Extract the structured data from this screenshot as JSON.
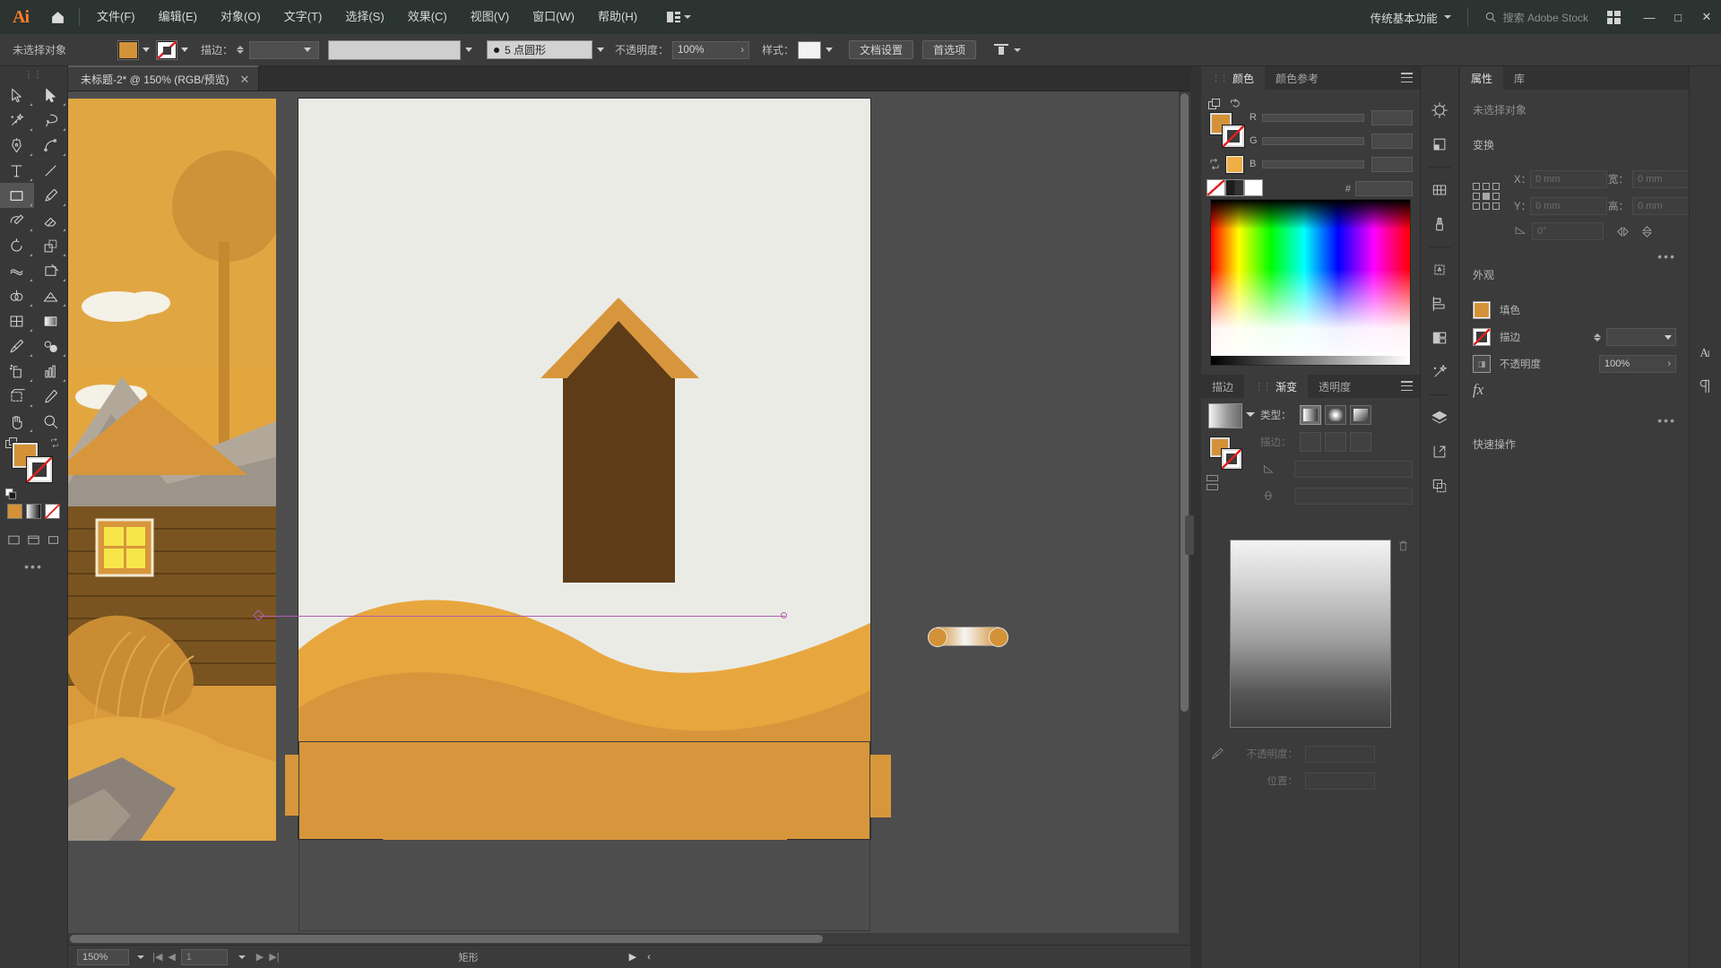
{
  "app": {
    "name": "Ai",
    "logo_color": "#ff7c2b",
    "accent_orange": "#d49238"
  },
  "menubar": {
    "home_icon": "home-icon",
    "items": [
      {
        "label": "文件(F)"
      },
      {
        "label": "编辑(E)"
      },
      {
        "label": "对象(O)"
      },
      {
        "label": "文字(T)"
      },
      {
        "label": "选择(S)"
      },
      {
        "label": "效果(C)"
      },
      {
        "label": "视图(V)"
      },
      {
        "label": "窗口(W)"
      },
      {
        "label": "帮助(H)"
      }
    ],
    "arrange_label": "",
    "workspace": "传统基本功能",
    "search_placeholder": "搜索 Adobe Stock",
    "window_buttons": [
      "—",
      "□",
      "✕"
    ]
  },
  "controlbar": {
    "selection_status": "未选择对象",
    "fill_color": "#d49238",
    "stroke_label": "描边：",
    "stroke_weight": "",
    "brush_label": "5 点圆形",
    "opacity_label": "不透明度：",
    "opacity_value": "100%",
    "style_label": "样式：",
    "doc_setup_button": "文档设置",
    "preferences_button": "首选项"
  },
  "toolbar": {
    "tools": [
      {
        "name": "selection-tool",
        "active": false
      },
      {
        "name": "direct-selection-tool",
        "active": false
      },
      {
        "name": "magic-wand-tool",
        "active": false
      },
      {
        "name": "lasso-tool",
        "active": false
      },
      {
        "name": "pen-tool",
        "active": false
      },
      {
        "name": "curvature-tool",
        "active": false
      },
      {
        "name": "type-tool",
        "active": false
      },
      {
        "name": "line-segment-tool",
        "active": false
      },
      {
        "name": "rectangle-tool",
        "active": true
      },
      {
        "name": "paintbrush-tool",
        "active": false
      },
      {
        "name": "shaper-tool",
        "active": false
      },
      {
        "name": "eraser-tool",
        "active": false
      },
      {
        "name": "rotate-tool",
        "active": false
      },
      {
        "name": "scale-tool",
        "active": false
      },
      {
        "name": "width-tool",
        "active": false
      },
      {
        "name": "free-transform-tool",
        "active": false
      },
      {
        "name": "shape-builder-tool",
        "active": false
      },
      {
        "name": "perspective-grid-tool",
        "active": false
      },
      {
        "name": "mesh-tool",
        "active": false
      },
      {
        "name": "gradient-tool",
        "active": false
      },
      {
        "name": "eyedropper-tool",
        "active": false
      },
      {
        "name": "blend-tool",
        "active": false
      },
      {
        "name": "symbol-sprayer-tool",
        "active": false
      },
      {
        "name": "column-graph-tool",
        "active": false
      },
      {
        "name": "artboard-tool",
        "active": false
      },
      {
        "name": "slice-tool",
        "active": false
      },
      {
        "name": "hand-tool",
        "active": false
      },
      {
        "name": "zoom-tool",
        "active": false
      }
    ],
    "fill_color": "#d49238",
    "stroke_color": "none"
  },
  "document": {
    "tab_title": "未标题-2* @ 150% (RGB/预览)",
    "close_label": "✕"
  },
  "statusbar": {
    "zoom": "150%",
    "page": "1",
    "tool_name": "矩形"
  },
  "panels": {
    "color": {
      "tabs": [
        {
          "label": "颜色",
          "active": true
        },
        {
          "label": "颜色参考",
          "active": false
        }
      ],
      "channels": [
        {
          "label": "R",
          "value": ""
        },
        {
          "label": "G",
          "value": ""
        },
        {
          "label": "B",
          "value": ""
        }
      ],
      "hex_label": "#",
      "hex_value": ""
    },
    "gradient": {
      "tabs": [
        {
          "label": "描边",
          "active": false
        },
        {
          "label": "渐变",
          "active": true
        },
        {
          "label": "透明度",
          "active": false
        }
      ],
      "type_label": "类型：",
      "type_options": [
        "linear-gradient",
        "radial-gradient",
        "freeform-gradient"
      ],
      "type_selected": 0,
      "stroke_label": "描边：",
      "angle_label": "",
      "aspect_label": "",
      "opacity_label": "不透明度：",
      "location_label": "位置："
    },
    "properties": {
      "tabs": [
        {
          "label": "属性",
          "active": true
        },
        {
          "label": "库",
          "active": false
        }
      ],
      "no_selection": "未选择对象",
      "transform_heading": "变换",
      "x_label": "X：",
      "x_value": "0 mm",
      "y_label": "Y：",
      "y_value": "0 mm",
      "w_label": "宽：",
      "w_value": "0 mm",
      "h_label": "高：",
      "h_value": "0 mm",
      "angle_value": "0°",
      "appearance_heading": "外观",
      "fill_label": "填色",
      "stroke_label": "描边",
      "opacity_label": "不透明度",
      "opacity_value": "100%",
      "fx_label": "fx",
      "quick_actions_heading": "快速操作"
    }
  },
  "icon_rail_right": [
    {
      "name": "color-guide-icon"
    },
    {
      "name": "libraries-icon"
    },
    {
      "name": "swatches-icon"
    },
    {
      "name": "brushes-icon"
    },
    {
      "name": "symbols-icon"
    },
    {
      "name": "align-icon"
    },
    {
      "name": "pathfinder-icon"
    },
    {
      "name": "magic-wand-panel-icon"
    },
    {
      "name": "layers-icon"
    },
    {
      "name": "artboards-icon"
    },
    {
      "name": "asset-export-icon"
    }
  ],
  "icon_rail_far_right": [
    {
      "name": "character-icon"
    },
    {
      "name": "paragraph-icon"
    }
  ],
  "artwork": {
    "description": "flat-illustration-desert-cabin",
    "colors": {
      "sky_gold": "#e3a63f",
      "sand_light": "#e8a73e",
      "sand_mid": "#d08f33",
      "sand_dark": "#c07f2c",
      "roof_brown": "#5d3c17",
      "wall_brown": "#6b4a1e",
      "roof_accent": "#d8963c",
      "cloud": "#f2efe4",
      "mountain": "#a9a196",
      "canvas_bg": "#ebebe6",
      "window_yellow": "#f6e64a"
    }
  }
}
